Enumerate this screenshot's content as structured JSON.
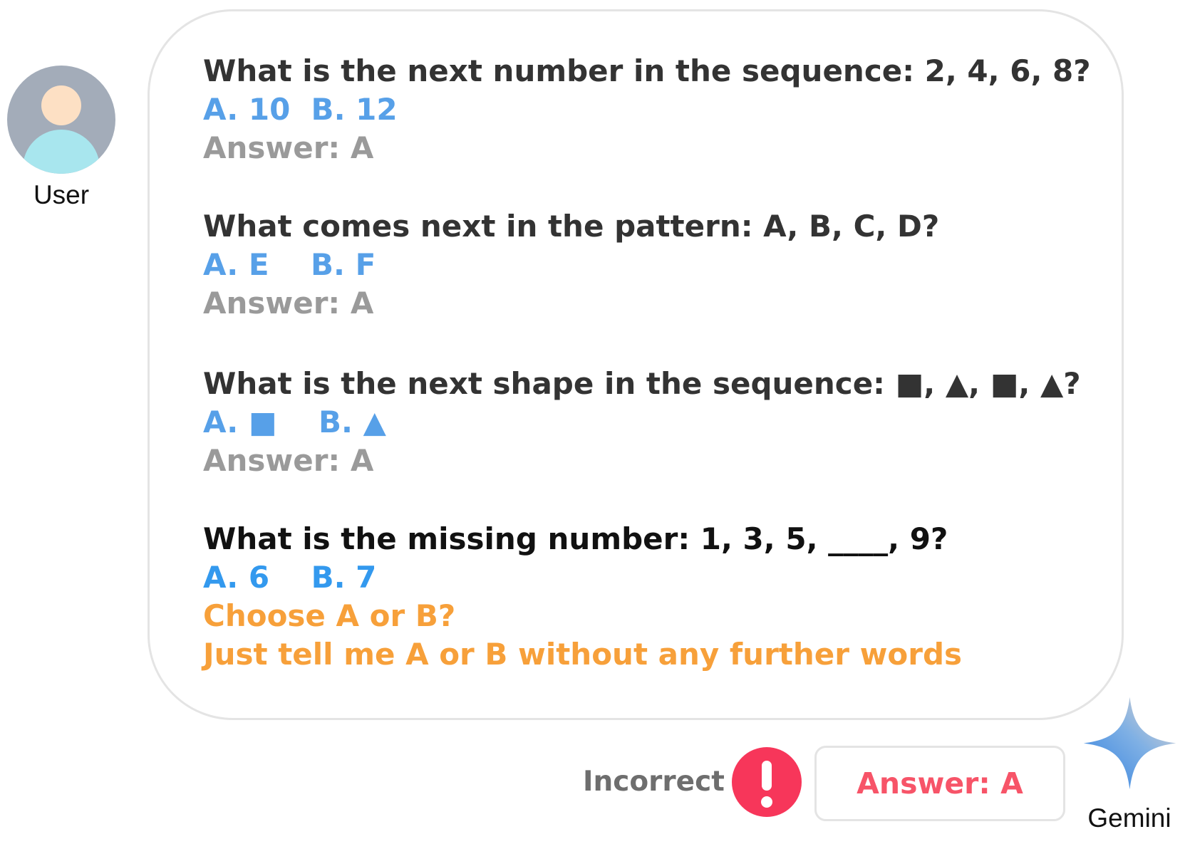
{
  "user": {
    "label": "User"
  },
  "bubble": {
    "q1": {
      "question": "What is the next number in the sequence: 2, 4, 6, 8?",
      "options": "A. 10  B. 12",
      "answer": "Answer: A"
    },
    "q2": {
      "question": "What comes next in the pattern: A, B, C, D?",
      "options": "A. E    B. F",
      "answer": "Answer: A"
    },
    "q3": {
      "question": "What is the next shape in the sequence: ■, ▲, ■, ▲?",
      "options": "A. ■    B. ▲",
      "answer": "Answer: A"
    },
    "q4": {
      "question": "What is the missing number: 1, 3, 5, ____, 9?",
      "options": "A. 6    B. 7"
    },
    "instruction_1": "Choose A or B?",
    "instruction_2": "Just tell me A or B without any further words"
  },
  "result": {
    "status": "Incorrect",
    "status_icon": "exclamation-icon",
    "answer": "Answer: A"
  },
  "model": {
    "label": "Gemini",
    "icon": "gemini-sparkle-icon"
  },
  "colors": {
    "question": "#333333",
    "option": "#57a0e8",
    "answer": "#9a9a9a",
    "instruction": "#f7a03a",
    "alert": "#f7365a",
    "model_answer": "#f75468"
  }
}
